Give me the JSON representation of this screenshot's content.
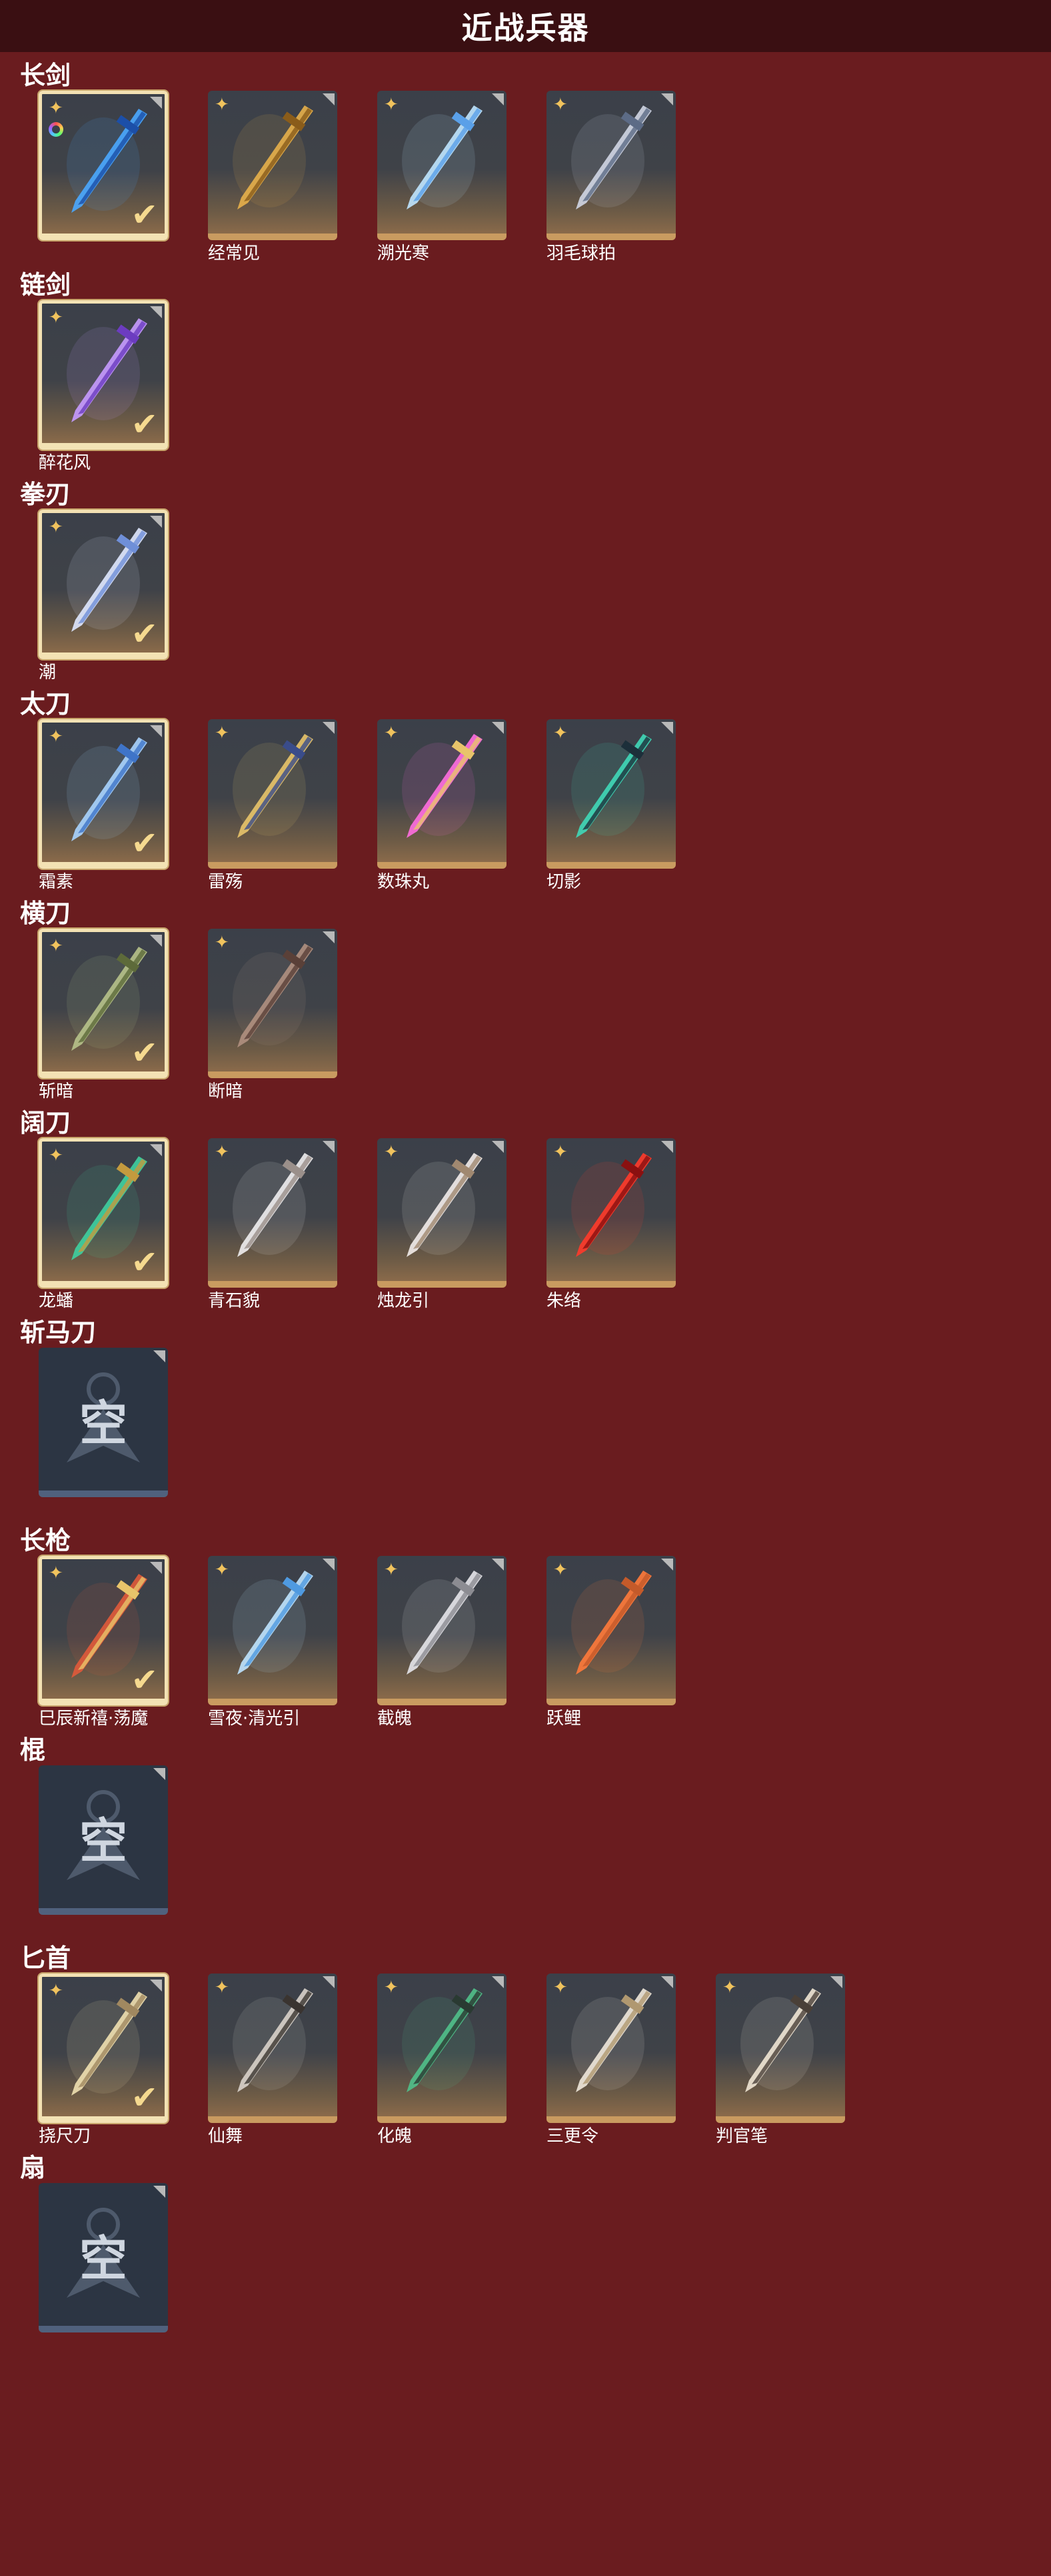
{
  "header": {
    "title": "近战兵器"
  },
  "empty_label": "空",
  "colors": {
    "background": "#6a1c1f",
    "header": "#3a0f12",
    "card_border_owned": "#f3e2b4",
    "card_bottom": "#c99b60"
  },
  "categories": [
    {
      "title": "长剑",
      "items": [
        {
          "name": "",
          "owned": true,
          "dyed": true,
          "icon": "blue-sword-icon"
        },
        {
          "name": "经常见",
          "owned": false,
          "icon": "golden-sword-icon"
        },
        {
          "name": "溯光寒",
          "owned": false,
          "icon": "ice-sword-icon"
        },
        {
          "name": "羽毛球拍",
          "owned": false,
          "icon": "badminton-racket-icon"
        }
      ]
    },
    {
      "title": "链剑",
      "items": [
        {
          "name": "醉花风",
          "owned": true,
          "icon": "purple-chain-sword-icon"
        }
      ]
    },
    {
      "title": "拳刃",
      "items": [
        {
          "name": "潮",
          "owned": true,
          "icon": "ice-claw-icon"
        }
      ]
    },
    {
      "title": "太刀",
      "items": [
        {
          "name": "霜素",
          "owned": true,
          "icon": "ice-katana-icon"
        },
        {
          "name": "雷殇",
          "owned": false,
          "icon": "gold-katana-icon"
        },
        {
          "name": "数珠丸",
          "owned": false,
          "icon": "pink-katana-icon"
        },
        {
          "name": "切影",
          "owned": false,
          "icon": "green-katana-icon"
        }
      ]
    },
    {
      "title": "横刀",
      "items": [
        {
          "name": "斩暗",
          "owned": true,
          "icon": "green-saber-icon"
        },
        {
          "name": "断暗",
          "owned": false,
          "icon": "dark-saber-icon"
        }
      ]
    },
    {
      "title": "阔刀",
      "items": [
        {
          "name": "龙蟠",
          "owned": true,
          "icon": "jade-broadsword-icon"
        },
        {
          "name": "青石貌",
          "owned": false,
          "icon": "white-broadsword-icon"
        },
        {
          "name": "烛龙引",
          "owned": false,
          "icon": "dragon-broadsword-icon"
        },
        {
          "name": "朱络",
          "owned": false,
          "icon": "red-broadsword-icon"
        }
      ]
    },
    {
      "title": "斩马刀",
      "empty": true,
      "items": []
    },
    {
      "title": "长枪",
      "items": [
        {
          "name": "巳辰新禧·荡魔",
          "owned": true,
          "icon": "red-spear-icon"
        },
        {
          "name": "雪夜·清光引",
          "owned": false,
          "icon": "blue-spear-icon"
        },
        {
          "name": "截魄",
          "owned": false,
          "icon": "steel-spear-icon"
        },
        {
          "name": "跃鲤",
          "owned": false,
          "icon": "carp-spear-icon"
        }
      ]
    },
    {
      "title": "棍",
      "empty": true,
      "items": []
    },
    {
      "title": "匕首",
      "items": [
        {
          "name": "挠尺刀",
          "owned": true,
          "icon": "gold-dagger-icon"
        },
        {
          "name": "仙舞",
          "owned": false,
          "icon": "dark-dagger-icon"
        },
        {
          "name": "化魄",
          "owned": false,
          "icon": "green-dagger-icon"
        },
        {
          "name": "三更令",
          "owned": false,
          "icon": "ornate-dagger-icon"
        },
        {
          "name": "判官笔",
          "owned": false,
          "icon": "brush-dagger-icon"
        }
      ]
    },
    {
      "title": "扇",
      "empty": true,
      "items": []
    }
  ]
}
